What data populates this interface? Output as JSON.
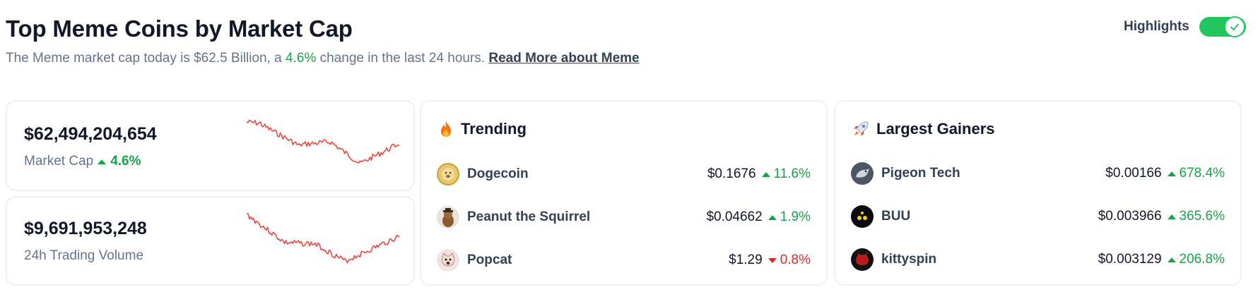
{
  "header": {
    "title": "Top Meme Coins by Market Cap",
    "subtitle_prefix": "The Meme market cap today is $62.5 Billion, a",
    "subtitle_pct": "4.6%",
    "subtitle_suffix": "change in the last 24 hours.",
    "read_more": "Read More about Meme",
    "highlights_label": "Highlights",
    "highlights_on": true
  },
  "colors": {
    "up": "#16a34a",
    "down": "#dc2626",
    "sparkline": "#ef4444",
    "toggle": "#22c55e"
  },
  "stats": {
    "market_cap": {
      "value": "$62,494,204,654",
      "label": "Market Cap",
      "change": "4.6%",
      "direction": "up"
    },
    "volume": {
      "value": "$9,691,953,248",
      "label": "24h Trading Volume"
    }
  },
  "trending": {
    "title": "Trending",
    "icon": "flame-icon",
    "items": [
      {
        "name": "Dogecoin",
        "price": "$0.1676",
        "change": "11.6%",
        "direction": "up",
        "icon": "dogecoin-icon"
      },
      {
        "name": "Peanut the Squirrel",
        "price": "$0.04662",
        "change": "1.9%",
        "direction": "up",
        "icon": "peanut-squirrel-icon"
      },
      {
        "name": "Popcat",
        "price": "$1.29",
        "change": "0.8%",
        "direction": "down",
        "icon": "popcat-icon"
      }
    ]
  },
  "gainers": {
    "title": "Largest Gainers",
    "icon": "rocket-icon",
    "items": [
      {
        "name": "Pigeon Tech",
        "price": "$0.00166",
        "change": "678.4%",
        "direction": "up",
        "icon": "pigeon-tech-icon"
      },
      {
        "name": "BUU",
        "price": "$0.003966",
        "change": "365.6%",
        "direction": "up",
        "icon": "buu-icon"
      },
      {
        "name": "kittyspin",
        "price": "$0.003129",
        "change": "206.8%",
        "direction": "up",
        "icon": "kittyspin-icon"
      }
    ]
  }
}
